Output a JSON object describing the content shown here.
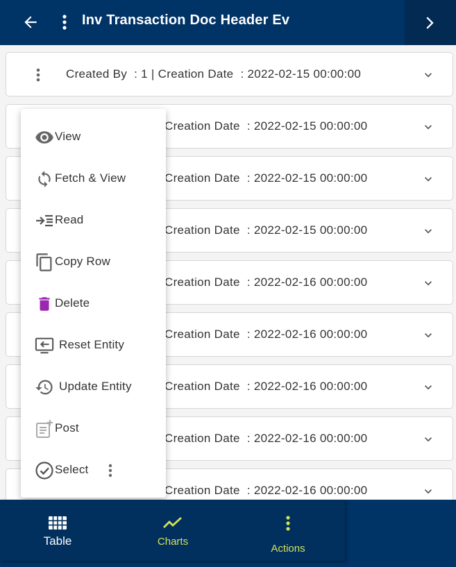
{
  "header": {
    "title": "Inv Transaction Doc Header Ev",
    "back_icon": "arrow-left-icon",
    "menu_icon": "kebab-icon",
    "next_icon": "chevron-right-icon",
    "bg_color": "#003366"
  },
  "records": [
    {
      "prefix": "Created By  : 1 | ",
      "text": "Created By  : 1 | Creation Date  : 2022-02-15 00:00:00"
    },
    {
      "text": "Creation Date  : 2022-02-15 00:00:00"
    },
    {
      "text": "Creation Date  : 2022-02-15 00:00:00"
    },
    {
      "text": "Creation Date  : 2022-02-15 00:00:00"
    },
    {
      "text": "Creation Date  : 2022-02-16 00:00:00"
    },
    {
      "text": "Creation Date  : 2022-02-16 00:00:00"
    },
    {
      "text": "Creation Date  : 2022-02-16 00:00:00"
    },
    {
      "text": "Creation Date  : 2022-02-16 00:00:00"
    },
    {
      "text": "Creation Date  : 2022-02-16 00:00:00"
    }
  ],
  "context_menu": {
    "items": [
      {
        "label": "View",
        "icon": "eye-icon"
      },
      {
        "label": "Fetch & View",
        "icon": "refresh-icon"
      },
      {
        "label": "Read",
        "icon": "read-icon"
      },
      {
        "label": "Copy Row",
        "icon": "copy-icon"
      },
      {
        "label": "Delete",
        "icon": "trash-icon",
        "color": "#9c27b0"
      },
      {
        "label": "Reset Entity",
        "icon": "reset-icon"
      },
      {
        "label": "Update Entity",
        "icon": "history-icon"
      },
      {
        "label": "Post",
        "icon": "post-icon"
      },
      {
        "label": "Select",
        "icon": "check-circle-icon"
      }
    ]
  },
  "bottom_nav": {
    "items": [
      {
        "label": "Table",
        "icon": "grid-icon",
        "color": "#ffffff"
      },
      {
        "label": "Charts",
        "icon": "line-chart-icon",
        "color": "#d4e157"
      },
      {
        "label": "Actions",
        "icon": "kebab-icon",
        "color": "#d4e157"
      }
    ]
  }
}
